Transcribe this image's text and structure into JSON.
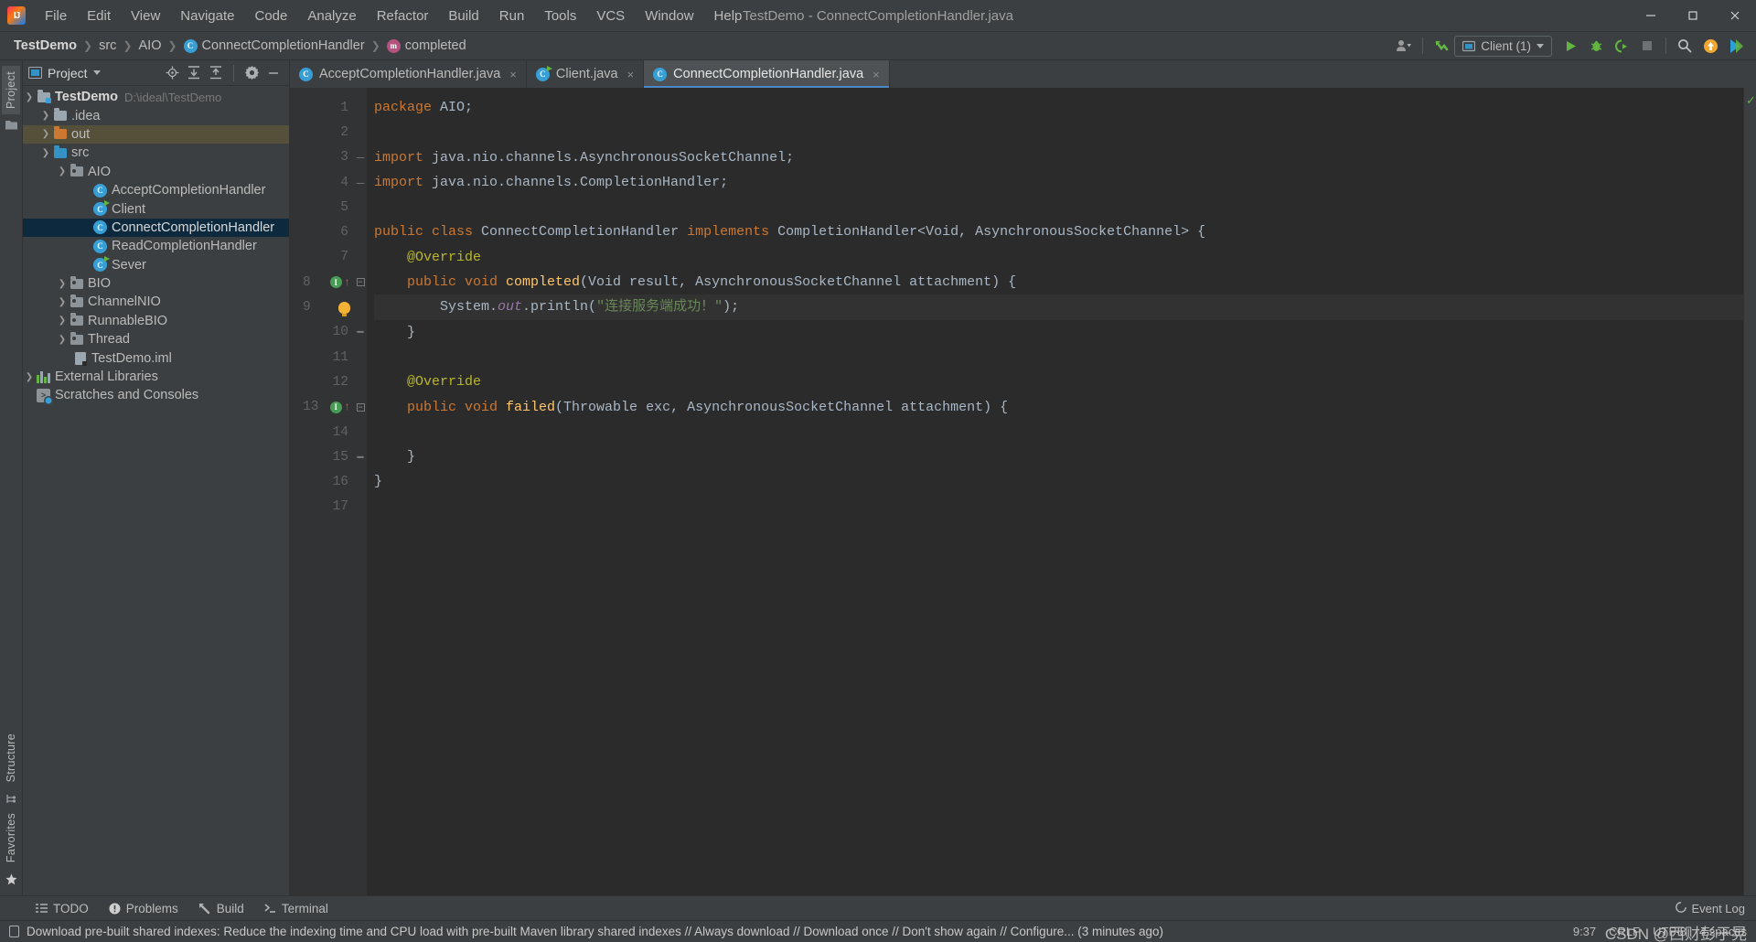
{
  "window": {
    "title": "TestDemo - ConnectCompletionHandler.java",
    "minimize_label": "—",
    "maximize_label": "❐",
    "close_label": "✕",
    "logo_text": "IJ"
  },
  "menu": {
    "items": [
      {
        "label": "File",
        "mnemonic": "F"
      },
      {
        "label": "Edit",
        "mnemonic": "E"
      },
      {
        "label": "View",
        "mnemonic": "V"
      },
      {
        "label": "Navigate",
        "mnemonic": "N"
      },
      {
        "label": "Code",
        "mnemonic": "C"
      },
      {
        "label": "Analyze",
        "mnemonic": "z"
      },
      {
        "label": "Refactor",
        "mnemonic": "R"
      },
      {
        "label": "Build",
        "mnemonic": "B"
      },
      {
        "label": "Run",
        "mnemonic": "u"
      },
      {
        "label": "Tools",
        "mnemonic": "T"
      },
      {
        "label": "VCS",
        "mnemonic": "S"
      },
      {
        "label": "Window",
        "mnemonic": "W"
      },
      {
        "label": "Help",
        "mnemonic": "H"
      }
    ]
  },
  "breadcrumbs": [
    {
      "label": "TestDemo",
      "icon": "",
      "bold": true
    },
    {
      "label": "src",
      "icon": ""
    },
    {
      "label": "AIO",
      "icon": ""
    },
    {
      "label": "ConnectCompletionHandler",
      "icon": "class-badge"
    },
    {
      "label": "completed",
      "icon": "method-badge"
    }
  ],
  "toolbar": {
    "account_icon": "user-icon",
    "vcs_update_icon": "vcs-update-icon",
    "run_config": {
      "label": "Client (1)",
      "icon": "run-config-icon"
    },
    "run_icon": "run-icon",
    "debug_icon": "debug-icon",
    "coverage_icon": "run-with-coverage-icon",
    "stop_icon": "stop-icon",
    "search_icon": "search-everywhere-icon",
    "update_icon": "update-project-icon",
    "idea_icon": "idea-rate-icon"
  },
  "left_strip": {
    "tabs": [
      "Project"
    ],
    "bottom_tabs": [
      "Structure",
      "Favorites"
    ]
  },
  "project_panel": {
    "title": "Project",
    "header_icons": [
      "locate-icon",
      "expand-all-icon",
      "collapse-all-icon",
      "settings-gear-icon",
      "hide-icon"
    ],
    "tree": [
      {
        "label": "TestDemo",
        "path": "D:\\ideal\\TestDemo",
        "icon": "module-folder",
        "arrow": "down",
        "indent": 0,
        "bold": true,
        "state": "normal"
      },
      {
        "label": ".idea",
        "icon": "folder",
        "arrow": "right",
        "indent": 1,
        "state": "normal"
      },
      {
        "label": "out",
        "icon": "folder-orange",
        "arrow": "right",
        "indent": 1,
        "state": "highlight"
      },
      {
        "label": "src",
        "icon": "folder-blue",
        "arrow": "down",
        "indent": 1,
        "state": "normal"
      },
      {
        "label": "AIO",
        "icon": "package-folder",
        "arrow": "down",
        "indent": 2,
        "state": "normal"
      },
      {
        "label": "AcceptCompletionHandler",
        "icon": "java-class",
        "arrow": "none",
        "indent": 3,
        "state": "normal"
      },
      {
        "label": "Client",
        "icon": "java-class-runnable",
        "arrow": "none",
        "indent": 3,
        "state": "normal"
      },
      {
        "label": "ConnectCompletionHandler",
        "icon": "java-class",
        "arrow": "none",
        "indent": 3,
        "state": "selected"
      },
      {
        "label": "ReadCompletionHandler",
        "icon": "java-class",
        "arrow": "none",
        "indent": 3,
        "state": "normal"
      },
      {
        "label": "Sever",
        "icon": "java-class-runnable",
        "arrow": "none",
        "indent": 3,
        "state": "normal"
      },
      {
        "label": "BIO",
        "icon": "package-folder",
        "arrow": "right",
        "indent": 2,
        "state": "normal"
      },
      {
        "label": "ChannelNIO",
        "icon": "package-folder",
        "arrow": "right",
        "indent": 2,
        "state": "normal"
      },
      {
        "label": "RunnableBIO",
        "icon": "package-folder",
        "arrow": "right",
        "indent": 2,
        "state": "normal"
      },
      {
        "label": "Thread",
        "icon": "package-folder",
        "arrow": "right",
        "indent": 2,
        "state": "normal"
      },
      {
        "label": "TestDemo.iml",
        "icon": "iml-file",
        "arrow": "none",
        "indent": 2,
        "state": "normal"
      },
      {
        "label": "External Libraries",
        "icon": "libraries",
        "arrow": "right",
        "indent": 0,
        "state": "normal"
      },
      {
        "label": "Scratches and Consoles",
        "icon": "scratches",
        "arrow": "none",
        "indent": 0,
        "state": "normal"
      }
    ]
  },
  "editor": {
    "tabs": [
      {
        "label": "AcceptCompletionHandler.java",
        "icon": "java-class",
        "active": false,
        "close": "×"
      },
      {
        "label": "Client.java",
        "icon": "java-class-runnable",
        "active": false,
        "close": "×"
      },
      {
        "label": "ConnectCompletionHandler.java",
        "icon": "java-class",
        "active": true,
        "close": "×"
      }
    ],
    "line_numbers": [
      "1",
      "2",
      "3",
      "4",
      "5",
      "6",
      "7",
      "8",
      "9",
      "10",
      "11",
      "12",
      "13",
      "14",
      "15",
      "16",
      "17"
    ],
    "current_line": 9,
    "inspection_status": "ok",
    "gutter_markers": [
      {
        "line": 8,
        "icons": [
          "implements-marker",
          "override-arrow"
        ]
      },
      {
        "line": 9,
        "icons": [
          "intention-bulb"
        ]
      },
      {
        "line": 13,
        "icons": [
          "implements-marker",
          "override-arrow"
        ]
      }
    ],
    "code_lines": [
      {
        "n": 1,
        "tokens": [
          {
            "t": "package ",
            "c": "kw"
          },
          {
            "t": "AIO;",
            "c": "pnc"
          }
        ]
      },
      {
        "n": 2,
        "tokens": []
      },
      {
        "n": 3,
        "tokens": [
          {
            "t": "import ",
            "c": "kw"
          },
          {
            "t": "java.nio.channels.AsynchronousSocketChannel;",
            "c": "typ"
          }
        ]
      },
      {
        "n": 4,
        "tokens": [
          {
            "t": "import ",
            "c": "kw"
          },
          {
            "t": "java.nio.channels.CompletionHandler;",
            "c": "typ"
          }
        ]
      },
      {
        "n": 5,
        "tokens": []
      },
      {
        "n": 6,
        "tokens": [
          {
            "t": "public class ",
            "c": "kw"
          },
          {
            "t": "ConnectCompletionHandler ",
            "c": "typ"
          },
          {
            "t": "implements ",
            "c": "kw"
          },
          {
            "t": "CompletionHandler<Void, AsynchronousSocketChannel> {",
            "c": "typ"
          }
        ]
      },
      {
        "n": 7,
        "tokens": [
          {
            "t": "    @Override",
            "c": "ann"
          }
        ]
      },
      {
        "n": 8,
        "tokens": [
          {
            "t": "    public void ",
            "c": "kw"
          },
          {
            "t": "completed",
            "c": "mth"
          },
          {
            "t": "(Void result, AsynchronousSocketChannel attachment) {",
            "c": "typ"
          }
        ]
      },
      {
        "n": 9,
        "tokens": [
          {
            "t": "        System.",
            "c": "typ"
          },
          {
            "t": "out",
            "c": "fld"
          },
          {
            "t": ".println(",
            "c": "typ"
          },
          {
            "t": "\"连接服务端成功！\"",
            "c": "str"
          },
          {
            "t": ");",
            "c": "typ"
          }
        ]
      },
      {
        "n": 10,
        "tokens": [
          {
            "t": "    }",
            "c": "pnc"
          }
        ]
      },
      {
        "n": 11,
        "tokens": []
      },
      {
        "n": 12,
        "tokens": [
          {
            "t": "    @Override",
            "c": "ann"
          }
        ]
      },
      {
        "n": 13,
        "tokens": [
          {
            "t": "    public void ",
            "c": "kw"
          },
          {
            "t": "failed",
            "c": "mth"
          },
          {
            "t": "(Throwable exc, AsynchronousSocketChannel attachment) {",
            "c": "typ"
          }
        ]
      },
      {
        "n": 14,
        "tokens": []
      },
      {
        "n": 15,
        "tokens": [
          {
            "t": "    }",
            "c": "pnc"
          }
        ]
      },
      {
        "n": 16,
        "tokens": [
          {
            "t": "}",
            "c": "pnc"
          }
        ]
      },
      {
        "n": 17,
        "tokens": []
      }
    ]
  },
  "bottom_tool_tabs": [
    {
      "label": "TODO",
      "icon": "todo-icon"
    },
    {
      "label": "Problems",
      "icon": "problems-icon"
    },
    {
      "label": "Build",
      "icon": "build-icon"
    },
    {
      "label": "Terminal",
      "icon": "terminal-icon"
    }
  ],
  "event_log": {
    "label": "Event Log",
    "icon": "event-log-icon"
  },
  "status_bar": {
    "message": "Download pre-built shared indexes: Reduce the indexing time and CPU load with pre-built Maven library shared indexes // Always download // Download once // Don't show again // Configure... (3 minutes ago)",
    "icon": "notification-icon",
    "position": "9:37",
    "line_separator": "CRLF",
    "encoding": "UTF-8",
    "indent": "4 spaces",
    "watermark": "CSDN @西财彭于晃"
  },
  "colors": {
    "accent": "#4a88c7",
    "keyword": "#cc7832",
    "string": "#6a8759",
    "annotation": "#bbb529",
    "method": "#ffc66d",
    "field": "#9876aa",
    "editor_bg": "#2b2b2b",
    "panel_bg": "#3c3f41",
    "selection": "#0d293e",
    "run_green": "#62b543"
  }
}
